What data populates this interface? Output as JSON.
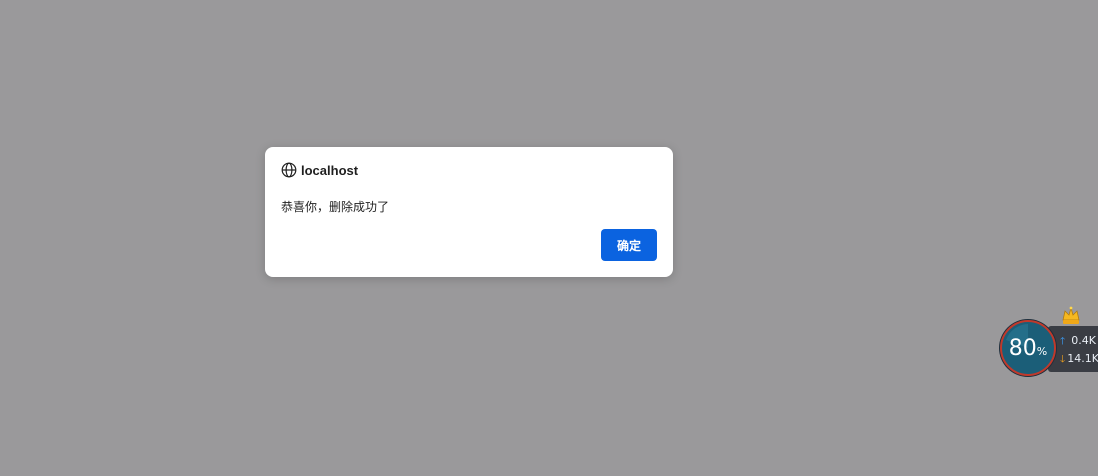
{
  "dialog": {
    "origin": "localhost",
    "message": "恭喜你，删除成功了",
    "ok_label": "确定",
    "accent_color": "#0b63e0"
  },
  "net_widget": {
    "usage_value": "80",
    "usage_unit": "%",
    "upload_speed": "0.4K",
    "download_speed": "14.1K",
    "upload_color": "#3ca2ff",
    "download_color": "#f3a21b"
  }
}
